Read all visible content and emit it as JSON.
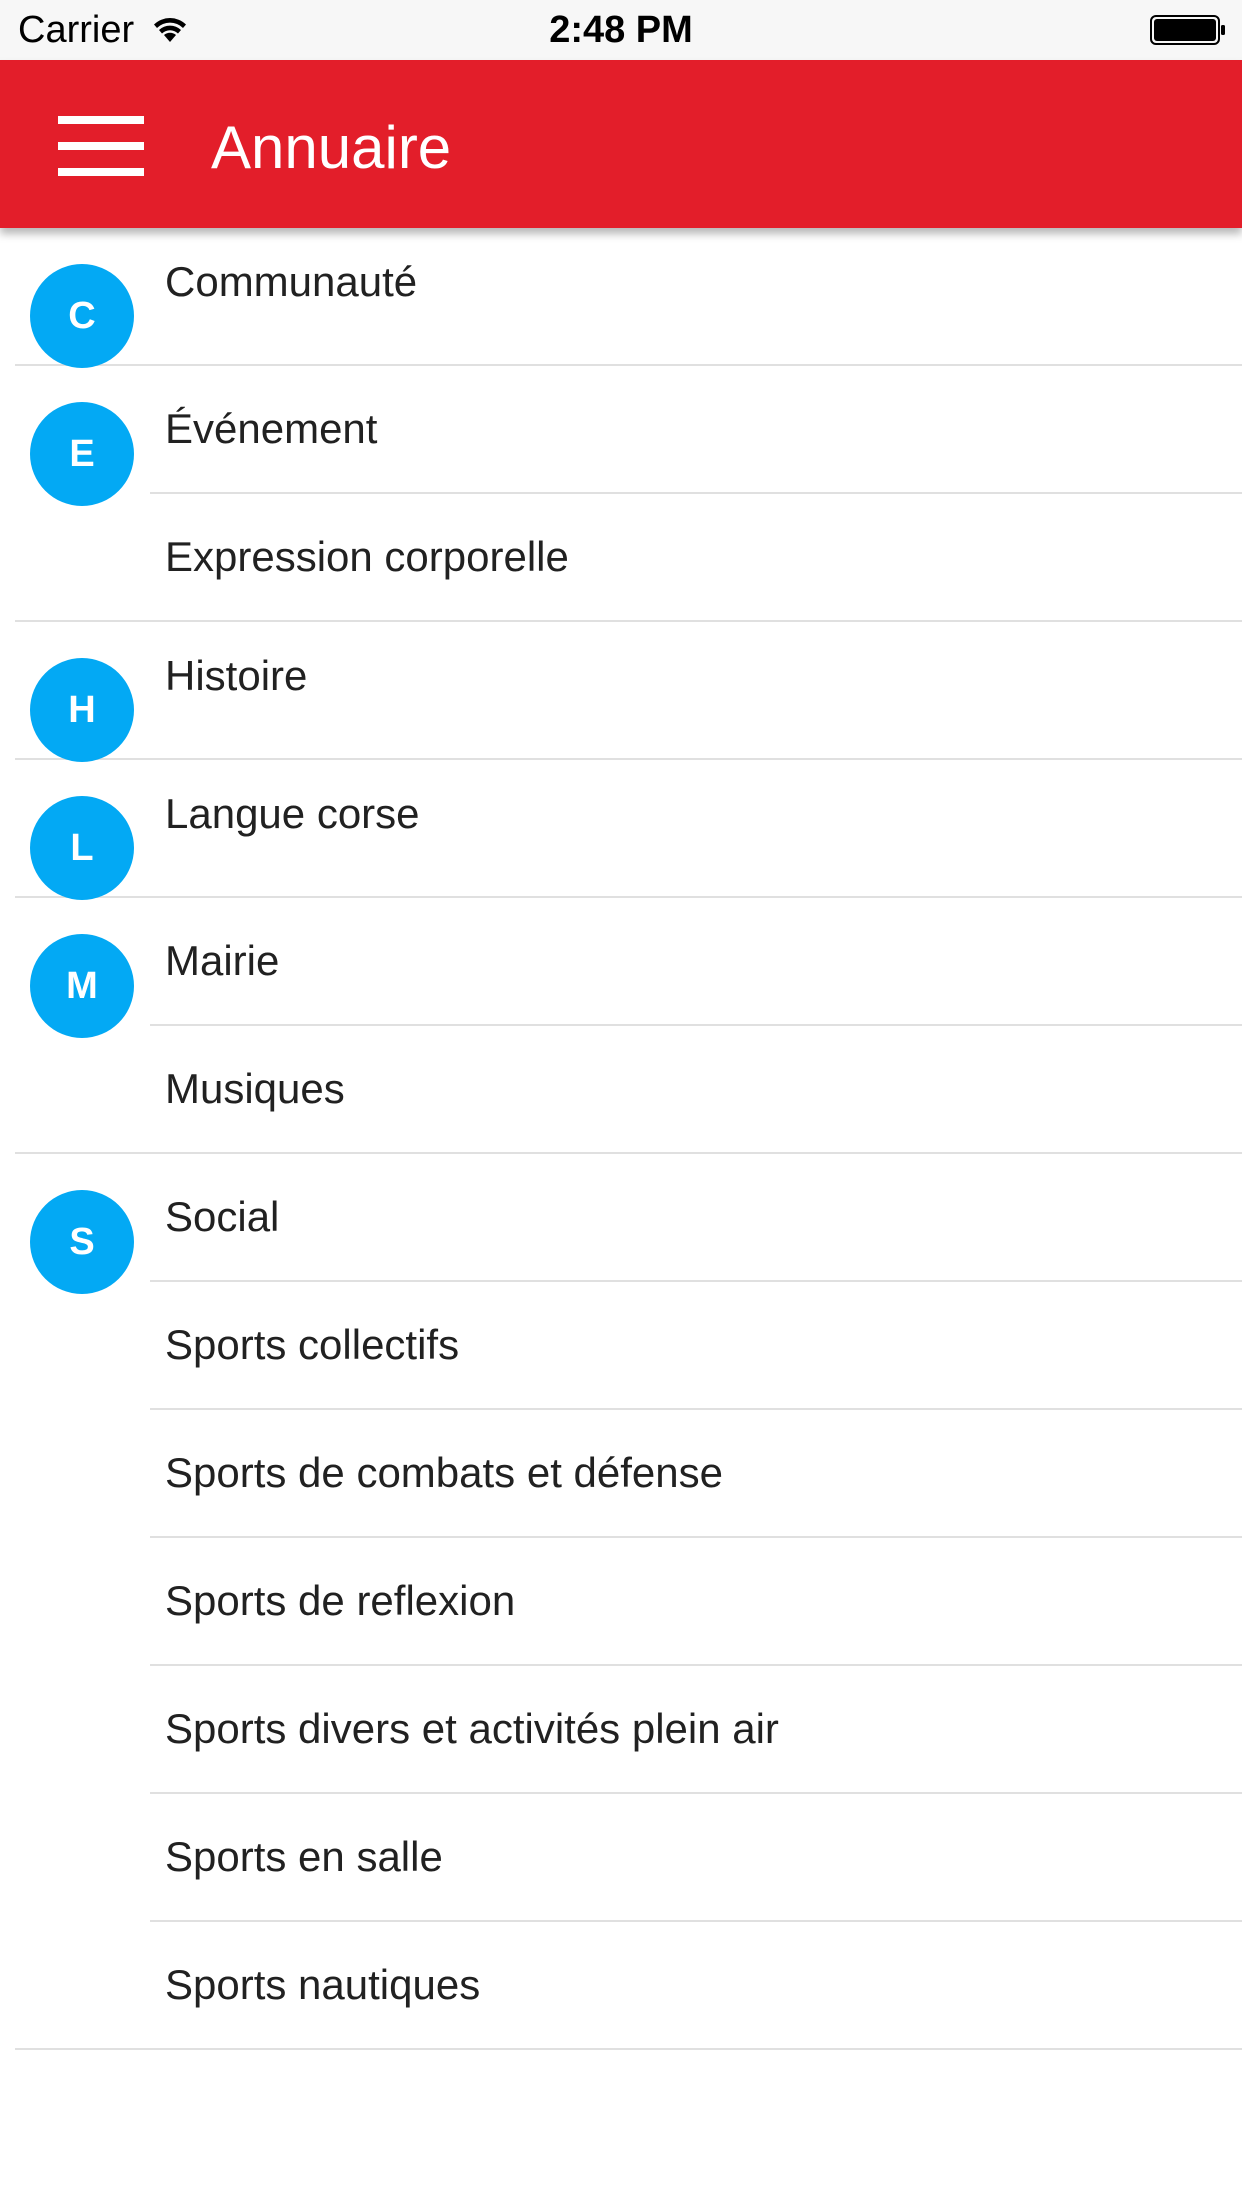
{
  "status_bar": {
    "carrier": "Carrier",
    "time": "2:48 PM",
    "wifi_icon": "wifi-icon",
    "battery_icon": "battery-full-icon"
  },
  "header": {
    "menu_icon": "hamburger-menu-icon",
    "title": "Annuaire",
    "color": "#e31e2a"
  },
  "accent_color": "#03a9f4",
  "groups": [
    {
      "letter": "C",
      "items": [
        "Communauté"
      ]
    },
    {
      "letter": "E",
      "items": [
        "Événement",
        "Expression corporelle"
      ]
    },
    {
      "letter": "H",
      "items": [
        "Histoire"
      ]
    },
    {
      "letter": "L",
      "items": [
        "Langue corse"
      ]
    },
    {
      "letter": "M",
      "items": [
        "Mairie",
        "Musiques"
      ]
    },
    {
      "letter": "S",
      "items": [
        "Social",
        "Sports collectifs",
        "Sports de combats et défense",
        "Sports de reflexion",
        "Sports divers et activités plein air",
        "Sports en salle",
        "Sports nautiques"
      ]
    }
  ]
}
